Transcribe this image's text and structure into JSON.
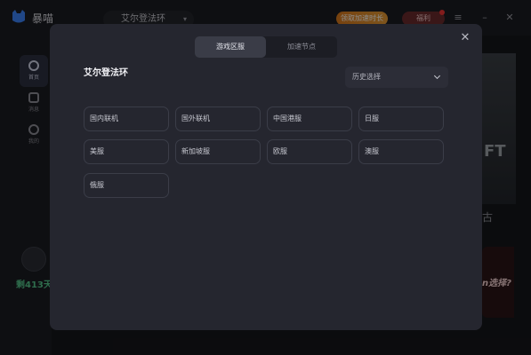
{
  "app": {
    "name": "暴喵",
    "game_select": "艾尔登法环",
    "promo_label": "领取加速时长",
    "gift_label": "福利"
  },
  "sidebar": {
    "items": [
      {
        "label": "首页"
      },
      {
        "label": "消息"
      },
      {
        "label": "我的"
      }
    ],
    "days_text": "剩413天"
  },
  "background": {
    "ft_text": "FT",
    "side_tail": "古",
    "promo_card_text": "n选择?"
  },
  "modal": {
    "tabs": [
      {
        "label": "游戏区服",
        "active": true
      },
      {
        "label": "加速节点",
        "active": false
      }
    ],
    "title": "艾尔登法环",
    "history_select": "历史选择",
    "regions": [
      {
        "label": "国内联机"
      },
      {
        "label": "国外联机"
      },
      {
        "label": "中国港服"
      },
      {
        "label": "日服"
      },
      {
        "label": "美服"
      },
      {
        "label": "新加坡服"
      },
      {
        "label": "欧服"
      },
      {
        "label": "澳服"
      },
      {
        "label": "俄服"
      }
    ]
  },
  "colors": {
    "modal_bg": "#25262f",
    "accent_green": "#54c58a",
    "promo_orange": "#e49a34"
  }
}
